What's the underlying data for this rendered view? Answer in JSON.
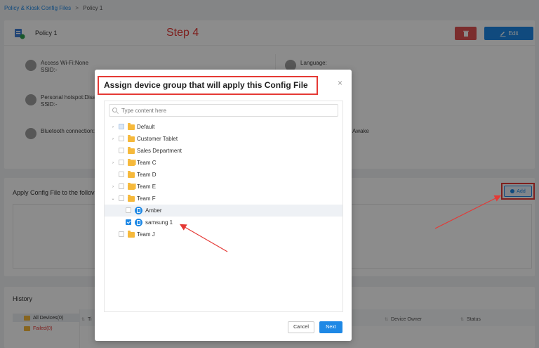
{
  "breadcrumb": {
    "root": "Policy & Kiosk Config Files",
    "separator": ">",
    "current": "Policy 1"
  },
  "policy": {
    "title": "Policy 1",
    "step_label": "Step 4",
    "edit_label": "Edit",
    "settings": {
      "wifi": {
        "line1": "Access Wi-Fi:None",
        "line2": "SSID:-"
      },
      "hotspot": {
        "line1": "Personal hotspot:Disa",
        "line2": "SSID:-"
      },
      "bluetooth": {
        "line1": "Bluetooth connection:N"
      },
      "language": {
        "line1": "Language:"
      },
      "screen": {
        "line1": "Awake"
      }
    }
  },
  "apply": {
    "title": "Apply Config File to the follov",
    "add_label": "Add"
  },
  "history": {
    "title": "History",
    "filters": [
      {
        "label": "All Devices(0)"
      },
      {
        "label": "Failed(0)"
      }
    ],
    "columns": {
      "time": "Ti",
      "owner": "Device Owner",
      "status": "Status"
    }
  },
  "modal": {
    "title": "Assign device group that will apply this Config File",
    "close": "×",
    "search_placeholder": "Type content here",
    "tree": [
      {
        "label": "Default",
        "type": "folder",
        "expand": "›",
        "check": "half"
      },
      {
        "label": "Customer Tablet",
        "type": "folder",
        "expand": "›",
        "check": "none"
      },
      {
        "label": "Sales Department",
        "type": "folder",
        "expand": "",
        "check": "none"
      },
      {
        "label": "Team C",
        "type": "folder-multi",
        "expand": "›",
        "check": "none"
      },
      {
        "label": "Team D",
        "type": "folder",
        "expand": "",
        "check": "none"
      },
      {
        "label": "Team E",
        "type": "folder-multi",
        "expand": "›",
        "check": "none"
      },
      {
        "label": "Team F",
        "type": "folder",
        "expand": "⌄",
        "check": "none"
      },
      {
        "label": "Amber",
        "type": "device",
        "expand": "",
        "check": "none"
      },
      {
        "label": "samsung 1",
        "type": "device",
        "expand": "",
        "check": "checked"
      },
      {
        "label": "Team J",
        "type": "folder",
        "expand": "",
        "check": "none"
      }
    ],
    "cancel_label": "Cancel",
    "next_label": "Next"
  },
  "colors": {
    "accent": "#1e88e5",
    "annotation": "#e53935",
    "danger": "#e05252",
    "folder": "#f6b93b"
  }
}
